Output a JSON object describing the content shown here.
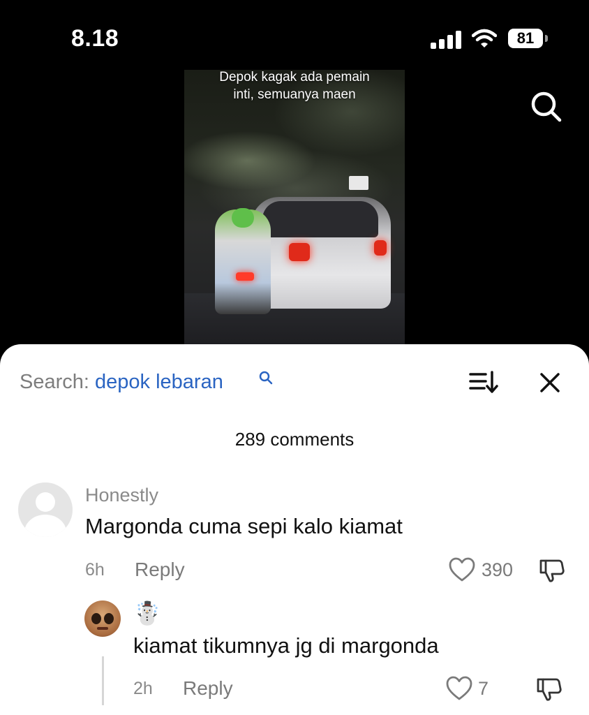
{
  "status_bar": {
    "time": "8.18",
    "battery": "81"
  },
  "video": {
    "caption_line1": "Depok kagak ada pemain",
    "caption_line2": "inti, semuanya maen"
  },
  "comments_header": {
    "search_prefix": "Search:",
    "search_term": "depok lebaran",
    "comment_count": "289 comments"
  },
  "comments": [
    {
      "username": "Honestly",
      "text": "Margonda cuma sepi kalo kiamat",
      "time": "6h",
      "reply_label": "Reply",
      "likes": "390",
      "replies": [
        {
          "username": "☃️",
          "text": "kiamat tikumnya jg di margonda",
          "time": "2h",
          "reply_label": "Reply",
          "likes": "7"
        }
      ]
    }
  ],
  "colors": {
    "search_term": "#2a64c2",
    "muted": "#8a8a8a"
  },
  "icons": [
    "search-icon",
    "sort-icon",
    "close-icon",
    "heart-icon",
    "dislike-icon",
    "signal-icon",
    "wifi-icon",
    "battery-icon"
  ]
}
